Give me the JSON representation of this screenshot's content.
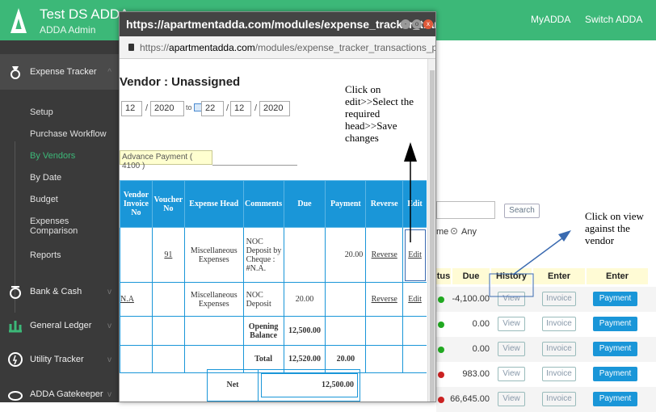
{
  "header": {
    "brand": "Test DS ADDA",
    "sub": "ADDA Admin",
    "link1": "MyADDA",
    "link2": "Switch ADDA"
  },
  "sidebar": {
    "expense": "Expense Tracker",
    "subs": [
      "Setup",
      "Purchase Workflow",
      "By Vendors",
      "By Date",
      "Budget",
      "Expenses",
      "Comparison",
      "Reports"
    ],
    "bank": "Bank & Cash",
    "ledger": "General Ledger",
    "utility": "Utility Tracker",
    "gate": "ADDA Gatekeeper"
  },
  "popup": {
    "title": "https://apartmentadda.com/modules/expense_tracker_tran...",
    "url_domain": "apartmentadda.com",
    "url_prefix": "https://",
    "url_rest": "/modules/expense_tracker_transactions_p...",
    "vendor_title": "Vendor : Unassigned",
    "from_d": "12",
    "from_y": "2020",
    "to_word": "to",
    "to_m": "22",
    "to_d": "12",
    "to_y": "2020",
    "tab": "Advance Payment ( 4100 )",
    "cols": [
      "Vendor Invoice No",
      "Voucher No",
      "Expense Head",
      "Comments",
      "Due",
      "Payment",
      "Reverse",
      "Edit"
    ],
    "rows": [
      {
        "inv": "",
        "voucher": "91",
        "head": "Miscellaneous Expenses",
        "comments": "NOC Deposit by Cheque : #N.A.",
        "due": "",
        "payment": "20.00",
        "reverse": "Reverse",
        "edit": "Edit"
      },
      {
        "inv": "N.A",
        "voucher": "",
        "head": "Miscellaneous Expenses",
        "comments": "NOC Deposit",
        "due": "20.00",
        "payment": "",
        "reverse": "Reverse",
        "edit": "Edit"
      }
    ],
    "opening_label": "Opening Balance",
    "opening": "12,500.00",
    "total_label": "Total",
    "total_due": "12,520.00",
    "total_pay": "20.00",
    "net_label": "Net",
    "net_val": "12,500.00"
  },
  "notes": {
    "edit": "Click on edit>>Select the required head>>Save changes",
    "view": "Click on view against the vendor"
  },
  "main": {
    "search": "Search",
    "radio1": "me",
    "radio2": "Any",
    "cols": [
      "tus",
      "Due",
      "History",
      "Enter Invoice",
      "Enter Payment"
    ],
    "rows": [
      {
        "due": "-4,100.00",
        "color": "#2a2"
      },
      {
        "due": "0.00",
        "color": "#2a2"
      },
      {
        "due": "0.00",
        "color": "#2a2"
      },
      {
        "due": "983.00",
        "color": "#c22"
      },
      {
        "due": "66,645.00",
        "color": "#c22"
      }
    ],
    "view": "View",
    "invoice": "Invoice",
    "payment": "Payment"
  },
  "colors": {
    "green": "#3cb878",
    "blue": "#1a96d8"
  }
}
